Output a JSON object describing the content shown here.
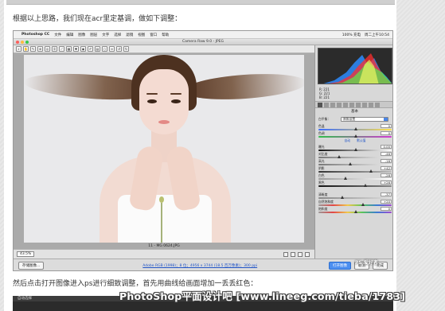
{
  "article": {
    "para1": "根据以上思路，我们现在acr里定基调，做如下调整：",
    "para2": "然后点击打开图像进入ps进行细致调整，首先用曲线给画面增加一丢丢红色：",
    "watermark": "PhotoShop平面设计吧 [www.lineeg.com/tieba/1783]"
  },
  "menubar": {
    "apple": "",
    "items": [
      "Photoshop CC",
      "文件",
      "编辑",
      "图像",
      "图层",
      "文字",
      "选择",
      "滤镜",
      "视图",
      "窗口",
      "帮助"
    ],
    "right": [
      "100% 充电",
      "周二上午10:54"
    ]
  },
  "window": {
    "title": "Camera Raw 9.0 - JPEG",
    "image_label": "11 - MG 0624.JPG",
    "zoom": "43.5%"
  },
  "panel": {
    "rgb": {
      "r_label": "R:",
      "g_label": "G:",
      "b_label": "B:",
      "r": "221",
      "g": "221",
      "b": "221"
    },
    "section_title": "基本",
    "wb_label": "白平衡：",
    "wb_value": "原照设置",
    "links": [
      "自动",
      "默认值"
    ],
    "sliders": [
      {
        "label": "色温",
        "value": "0"
      },
      {
        "label": "色调",
        "value": "0"
      },
      {
        "label": "曝光",
        "value": "0.00"
      },
      {
        "label": "对比度",
        "value": "-46"
      },
      {
        "label": "高光",
        "value": "-16"
      },
      {
        "label": "阴影",
        "value": "+42"
      },
      {
        "label": "白色",
        "value": "-28"
      },
      {
        "label": "黑色",
        "value": "+26"
      },
      {
        "label": "清晰度",
        "value": "-37"
      },
      {
        "label": "自然饱和度",
        "value": "+20"
      },
      {
        "label": "饱和度",
        "value": "0"
      }
    ]
  },
  "footer": {
    "save": "存储图像...",
    "link": "Adobe RGB (1998)；8 位；4956 x 3744 (18.5 百万像素)；300 ppi",
    "open": "打开图像",
    "cancel": "取消",
    "done": "完成"
  },
  "bottom_strip": {
    "label": "自动选择"
  },
  "corner_logo": "PS 爱好者"
}
